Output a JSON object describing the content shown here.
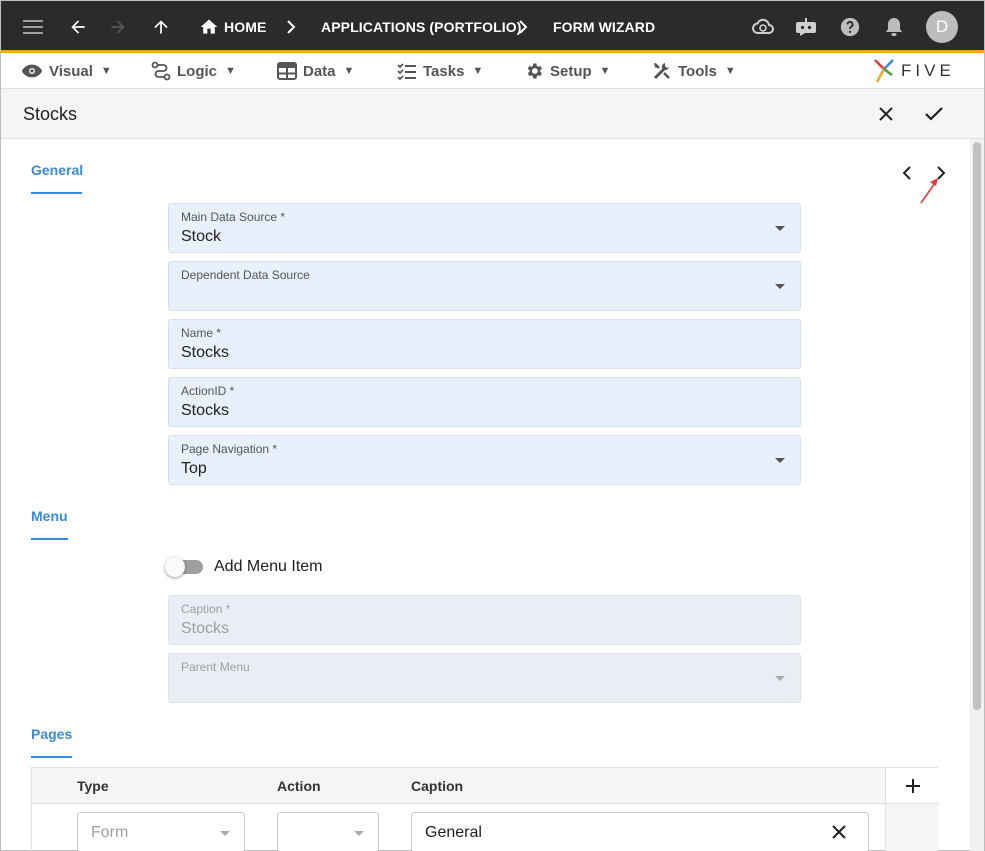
{
  "topbar": {
    "breadcrumbs": [
      "HOME",
      "APPLICATIONS (PORTFOLIO)",
      "FORM WIZARD"
    ],
    "avatar_initial": "D"
  },
  "menubar": {
    "items": [
      {
        "label": "Visual",
        "icon": "eye-icon"
      },
      {
        "label": "Logic",
        "icon": "flow-icon"
      },
      {
        "label": "Data",
        "icon": "table-icon"
      },
      {
        "label": "Tasks",
        "icon": "checklist-icon"
      },
      {
        "label": "Setup",
        "icon": "gear-icon"
      },
      {
        "label": "Tools",
        "icon": "tools-icon"
      }
    ],
    "logo_text": "FIVE"
  },
  "page": {
    "title": "Stocks"
  },
  "general": {
    "section_label": "General",
    "fields": [
      {
        "label": "Main Data Source *",
        "value": "Stock",
        "dropdown": true
      },
      {
        "label": "Dependent Data Source",
        "value": "",
        "dropdown": true
      },
      {
        "label": "Name *",
        "value": "Stocks",
        "dropdown": false
      },
      {
        "label": "ActionID *",
        "value": "Stocks",
        "dropdown": false
      },
      {
        "label": "Page Navigation *",
        "value": "Top",
        "dropdown": true
      }
    ]
  },
  "menu": {
    "section_label": "Menu",
    "toggle_label": "Add Menu Item",
    "toggle_on": false,
    "caption_label": "Caption *",
    "caption_value": "Stocks",
    "parent_label": "Parent Menu",
    "parent_value": ""
  },
  "pages": {
    "section_label": "Pages",
    "columns": [
      "Type",
      "Action",
      "Caption"
    ],
    "rows": [
      {
        "type_placeholder": "Form",
        "action": "",
        "caption": "General"
      }
    ]
  },
  "colors": {
    "accent": "#3b8ad9",
    "topbar_bg": "#2b2b2b",
    "topbar_border": "#f5a623",
    "field_bg": "#e8f0fc",
    "annotation_arrow": "#e53935"
  }
}
